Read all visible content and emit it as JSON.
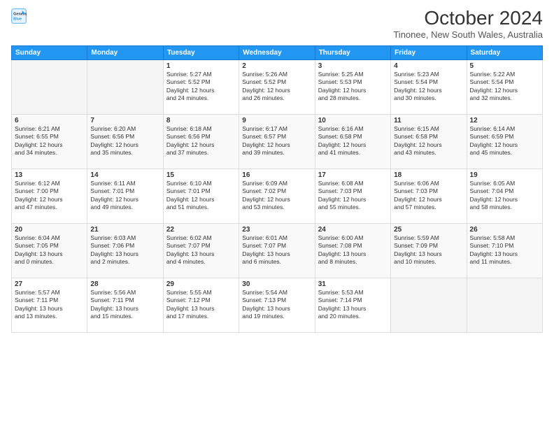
{
  "logo": {
    "line1": "General",
    "line2": "Blue"
  },
  "title": "October 2024",
  "location": "Tinonee, New South Wales, Australia",
  "weekdays": [
    "Sunday",
    "Monday",
    "Tuesday",
    "Wednesday",
    "Thursday",
    "Friday",
    "Saturday"
  ],
  "weeks": [
    [
      {
        "day": "",
        "info": ""
      },
      {
        "day": "",
        "info": ""
      },
      {
        "day": "1",
        "info": "Sunrise: 5:27 AM\nSunset: 5:52 PM\nDaylight: 12 hours\nand 24 minutes."
      },
      {
        "day": "2",
        "info": "Sunrise: 5:26 AM\nSunset: 5:52 PM\nDaylight: 12 hours\nand 26 minutes."
      },
      {
        "day": "3",
        "info": "Sunrise: 5:25 AM\nSunset: 5:53 PM\nDaylight: 12 hours\nand 28 minutes."
      },
      {
        "day": "4",
        "info": "Sunrise: 5:23 AM\nSunset: 5:54 PM\nDaylight: 12 hours\nand 30 minutes."
      },
      {
        "day": "5",
        "info": "Sunrise: 5:22 AM\nSunset: 5:54 PM\nDaylight: 12 hours\nand 32 minutes."
      }
    ],
    [
      {
        "day": "6",
        "info": "Sunrise: 6:21 AM\nSunset: 6:55 PM\nDaylight: 12 hours\nand 34 minutes."
      },
      {
        "day": "7",
        "info": "Sunrise: 6:20 AM\nSunset: 6:56 PM\nDaylight: 12 hours\nand 35 minutes."
      },
      {
        "day": "8",
        "info": "Sunrise: 6:18 AM\nSunset: 6:56 PM\nDaylight: 12 hours\nand 37 minutes."
      },
      {
        "day": "9",
        "info": "Sunrise: 6:17 AM\nSunset: 6:57 PM\nDaylight: 12 hours\nand 39 minutes."
      },
      {
        "day": "10",
        "info": "Sunrise: 6:16 AM\nSunset: 6:58 PM\nDaylight: 12 hours\nand 41 minutes."
      },
      {
        "day": "11",
        "info": "Sunrise: 6:15 AM\nSunset: 6:58 PM\nDaylight: 12 hours\nand 43 minutes."
      },
      {
        "day": "12",
        "info": "Sunrise: 6:14 AM\nSunset: 6:59 PM\nDaylight: 12 hours\nand 45 minutes."
      }
    ],
    [
      {
        "day": "13",
        "info": "Sunrise: 6:12 AM\nSunset: 7:00 PM\nDaylight: 12 hours\nand 47 minutes."
      },
      {
        "day": "14",
        "info": "Sunrise: 6:11 AM\nSunset: 7:01 PM\nDaylight: 12 hours\nand 49 minutes."
      },
      {
        "day": "15",
        "info": "Sunrise: 6:10 AM\nSunset: 7:01 PM\nDaylight: 12 hours\nand 51 minutes."
      },
      {
        "day": "16",
        "info": "Sunrise: 6:09 AM\nSunset: 7:02 PM\nDaylight: 12 hours\nand 53 minutes."
      },
      {
        "day": "17",
        "info": "Sunrise: 6:08 AM\nSunset: 7:03 PM\nDaylight: 12 hours\nand 55 minutes."
      },
      {
        "day": "18",
        "info": "Sunrise: 6:06 AM\nSunset: 7:03 PM\nDaylight: 12 hours\nand 57 minutes."
      },
      {
        "day": "19",
        "info": "Sunrise: 6:05 AM\nSunset: 7:04 PM\nDaylight: 12 hours\nand 58 minutes."
      }
    ],
    [
      {
        "day": "20",
        "info": "Sunrise: 6:04 AM\nSunset: 7:05 PM\nDaylight: 13 hours\nand 0 minutes."
      },
      {
        "day": "21",
        "info": "Sunrise: 6:03 AM\nSunset: 7:06 PM\nDaylight: 13 hours\nand 2 minutes."
      },
      {
        "day": "22",
        "info": "Sunrise: 6:02 AM\nSunset: 7:07 PM\nDaylight: 13 hours\nand 4 minutes."
      },
      {
        "day": "23",
        "info": "Sunrise: 6:01 AM\nSunset: 7:07 PM\nDaylight: 13 hours\nand 6 minutes."
      },
      {
        "day": "24",
        "info": "Sunrise: 6:00 AM\nSunset: 7:08 PM\nDaylight: 13 hours\nand 8 minutes."
      },
      {
        "day": "25",
        "info": "Sunrise: 5:59 AM\nSunset: 7:09 PM\nDaylight: 13 hours\nand 10 minutes."
      },
      {
        "day": "26",
        "info": "Sunrise: 5:58 AM\nSunset: 7:10 PM\nDaylight: 13 hours\nand 11 minutes."
      }
    ],
    [
      {
        "day": "27",
        "info": "Sunrise: 5:57 AM\nSunset: 7:11 PM\nDaylight: 13 hours\nand 13 minutes."
      },
      {
        "day": "28",
        "info": "Sunrise: 5:56 AM\nSunset: 7:11 PM\nDaylight: 13 hours\nand 15 minutes."
      },
      {
        "day": "29",
        "info": "Sunrise: 5:55 AM\nSunset: 7:12 PM\nDaylight: 13 hours\nand 17 minutes."
      },
      {
        "day": "30",
        "info": "Sunrise: 5:54 AM\nSunset: 7:13 PM\nDaylight: 13 hours\nand 19 minutes."
      },
      {
        "day": "31",
        "info": "Sunrise: 5:53 AM\nSunset: 7:14 PM\nDaylight: 13 hours\nand 20 minutes."
      },
      {
        "day": "",
        "info": ""
      },
      {
        "day": "",
        "info": ""
      }
    ]
  ]
}
